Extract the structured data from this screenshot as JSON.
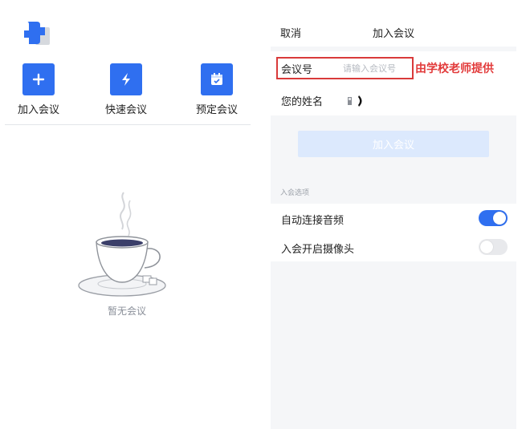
{
  "home": {
    "actions": [
      {
        "label": "加入会议",
        "icon": "plus-icon"
      },
      {
        "label": "快速会议",
        "icon": "lightning-icon"
      },
      {
        "label": "预定会议",
        "icon": "calendar-icon"
      }
    ],
    "empty_text": "暂无会议"
  },
  "join": {
    "cancel_label": "取消",
    "title": "加入会议",
    "meeting_id_label": "会议号",
    "meeting_id_placeholder": "请输入会议号",
    "meeting_id_value": "",
    "annotation": "由学校老师提供",
    "name_label": "您的姓名",
    "join_button": "加入会议",
    "options_header": "入会选项",
    "options": [
      {
        "label": "自动连接音频",
        "enabled": true
      },
      {
        "label": "入会开启摄像头",
        "enabled": false
      }
    ]
  },
  "colors": {
    "accent": "#2f6ff0",
    "button_disabled": "#dce9fd",
    "annotation": "#e23b3b",
    "panel_bg": "#f5f6f8"
  }
}
